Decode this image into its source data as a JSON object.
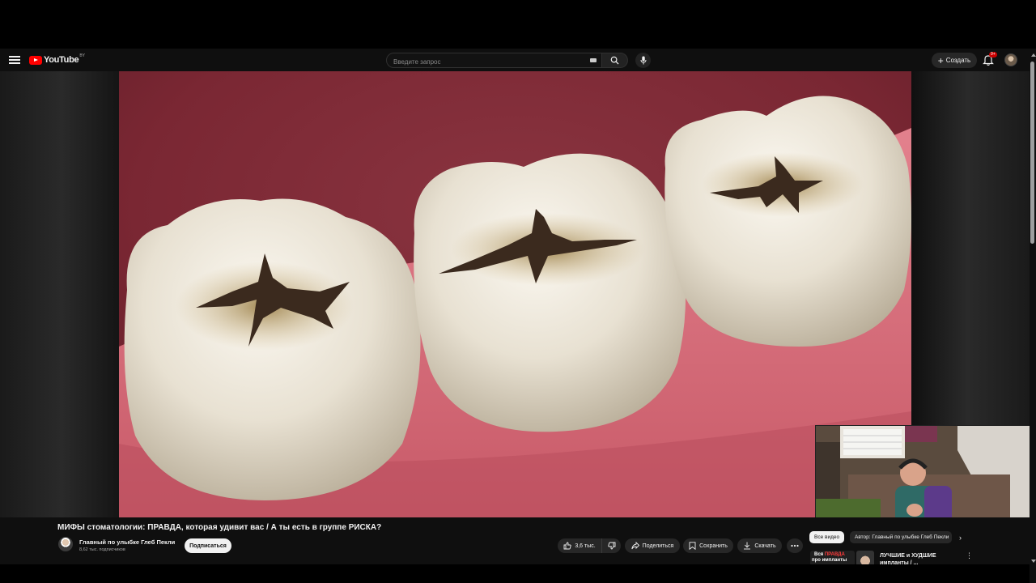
{
  "header": {
    "logo_text": "YouTube",
    "logo_region": "BY",
    "search_placeholder": "Введите запрос",
    "create_label": "Создать",
    "notification_badge": "9+"
  },
  "video": {
    "title": "МИФЫ стоматологии: ПРАВДА, которая удивит вас / А ты есть в группе РИСКА?",
    "channel_name": "Главный по улыбке Глеб Пекли",
    "subscribers": "8,62 тыс. подписчиков",
    "subscribe_label": "Подписаться",
    "like_count": "3,6 тыс.",
    "share_label": "Поделиться",
    "save_label": "Сохранить",
    "download_label": "Скачать"
  },
  "chips": {
    "all_label": "Все видео",
    "author_label": "Автор: Главный по улыбке Глеб Пекли"
  },
  "recommendation": {
    "thumb_line1_a": "Вся",
    "thumb_line1_b": "ПРАВДА",
    "thumb_line2": "про импланты",
    "title_line1": "ЛУЧШИЕ и ХУДШИЕ",
    "title_line2": "импланты / ..."
  },
  "colors": {
    "background": "#0f0f0f",
    "brand_red": "#ff0000",
    "pill_bg": "#272727",
    "text": "#f1f1f1",
    "gum": "#d9707c",
    "tooth": "#eae4d6",
    "caries": "#3b2a1e"
  },
  "icons": [
    "menu-icon",
    "youtube-logo-icon",
    "keyboard-icon",
    "search-icon",
    "mic-icon",
    "plus-icon",
    "bell-icon",
    "like-icon",
    "dislike-icon",
    "share-icon",
    "save-icon",
    "download-icon",
    "more-icon",
    "chevron-right-icon"
  ]
}
